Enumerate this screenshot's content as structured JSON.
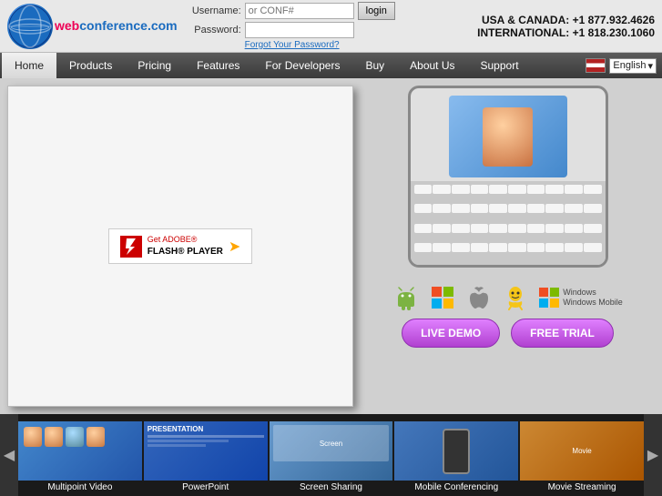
{
  "header": {
    "logo_text": "web",
    "logo_text2": "conference",
    "logo_tld": ".com",
    "username_label": "Username:",
    "password_label": "Password:",
    "username_placeholder": "or CONF#",
    "login_button": "login",
    "forgot_password": "Forgot Your Password?",
    "phone_usa": "USA & CANADA: +1 877.932.4626",
    "phone_intl": "INTERNATIONAL: +1 818.230.1060"
  },
  "navbar": {
    "items": [
      {
        "label": "Home",
        "active": true
      },
      {
        "label": "Products",
        "active": false
      },
      {
        "label": "Pricing",
        "active": false
      },
      {
        "label": "Features",
        "active": false
      },
      {
        "label": "For Developers",
        "active": false
      },
      {
        "label": "Buy",
        "active": false
      },
      {
        "label": "About Us",
        "active": false
      },
      {
        "label": "Support",
        "active": false
      }
    ],
    "language": "English"
  },
  "main": {
    "flash_box": {
      "get_label": "Get ADOBE®",
      "flash_label": "FLASH® PLAYER"
    },
    "demo_buttons": {
      "live_demo": "LIVE DEMO",
      "free_trial": "FREE TRIAL"
    },
    "os_label": "Windows Mobile"
  },
  "bottom_strip": {
    "items": [
      {
        "label": "Multipoint Video"
      },
      {
        "label": "PowerPoint"
      },
      {
        "label": "Screen Sharing"
      },
      {
        "label": "Mobile Conferencing"
      },
      {
        "label": "Movie Streaming"
      }
    ]
  }
}
